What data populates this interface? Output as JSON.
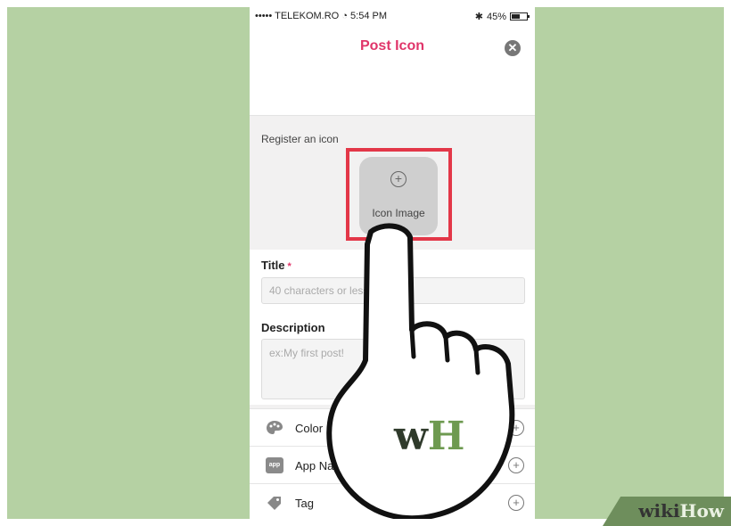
{
  "status_bar": {
    "carrier": "••••• TELEKOM.RO",
    "time": "5:54 PM",
    "battery": "45%"
  },
  "nav": {
    "title": "Post Icon"
  },
  "register": {
    "label": "Register an icon",
    "icon_image_label": "Icon Image"
  },
  "title_field": {
    "label": "Title",
    "required_mark": "*",
    "placeholder": "40 characters or less"
  },
  "description_field": {
    "label": "Description",
    "placeholder": "ex:My first post!"
  },
  "rows": [
    {
      "label": "Color",
      "icon": "palette-icon"
    },
    {
      "label": "App Name",
      "icon": "app-icon",
      "badge_text": "app"
    },
    {
      "label": "Tag",
      "icon": "tag-icon"
    }
  ],
  "overlay": {
    "logo_text": "wH",
    "watermark_prefix": "wiki",
    "watermark_suffix": "How"
  },
  "colors": {
    "background": "#b5d1a3",
    "accent_pink": "#e0356a",
    "highlight_red": "#e33748",
    "logo_dark": "#2f3a2b",
    "logo_green": "#6e9a50"
  }
}
